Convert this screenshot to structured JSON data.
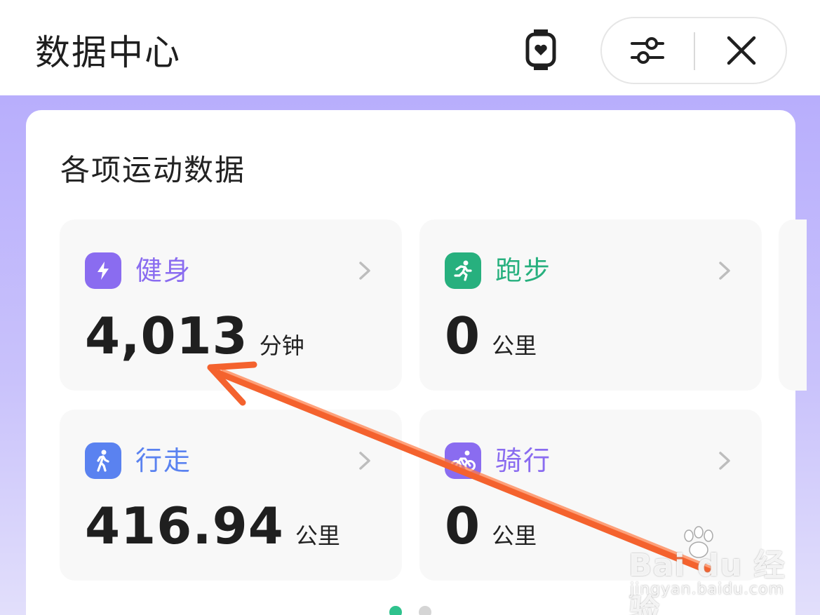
{
  "header": {
    "title": "数据中心",
    "watch_icon": "smartwatch-heart-icon",
    "filter_icon": "sliders-icon",
    "close_icon": "close-icon"
  },
  "card": {
    "title": "各项运动数据",
    "tiles": [
      {
        "name": "健身",
        "value": "4,013",
        "unit": "分钟",
        "icon": "lightning-icon",
        "color": "#8a6cf0"
      },
      {
        "name": "跑步",
        "value": "0",
        "unit": "公里",
        "icon": "running-icon",
        "color": "#27b07e"
      },
      {
        "name": "行走",
        "value": "416.94",
        "unit": "公里",
        "icon": "walking-icon",
        "color": "#5a82f0"
      },
      {
        "name": "骑行",
        "value": "0",
        "unit": "公里",
        "icon": "cycling-icon",
        "color": "#8a6cf0"
      }
    ]
  },
  "pagination": {
    "total": 2,
    "active": 1,
    "active_color": "#2fc28d"
  },
  "annotation": {
    "arrow_color": "#f4622e"
  },
  "watermark": {
    "brand": "Bai du 经验",
    "url": "jingyan.baidu.com"
  }
}
